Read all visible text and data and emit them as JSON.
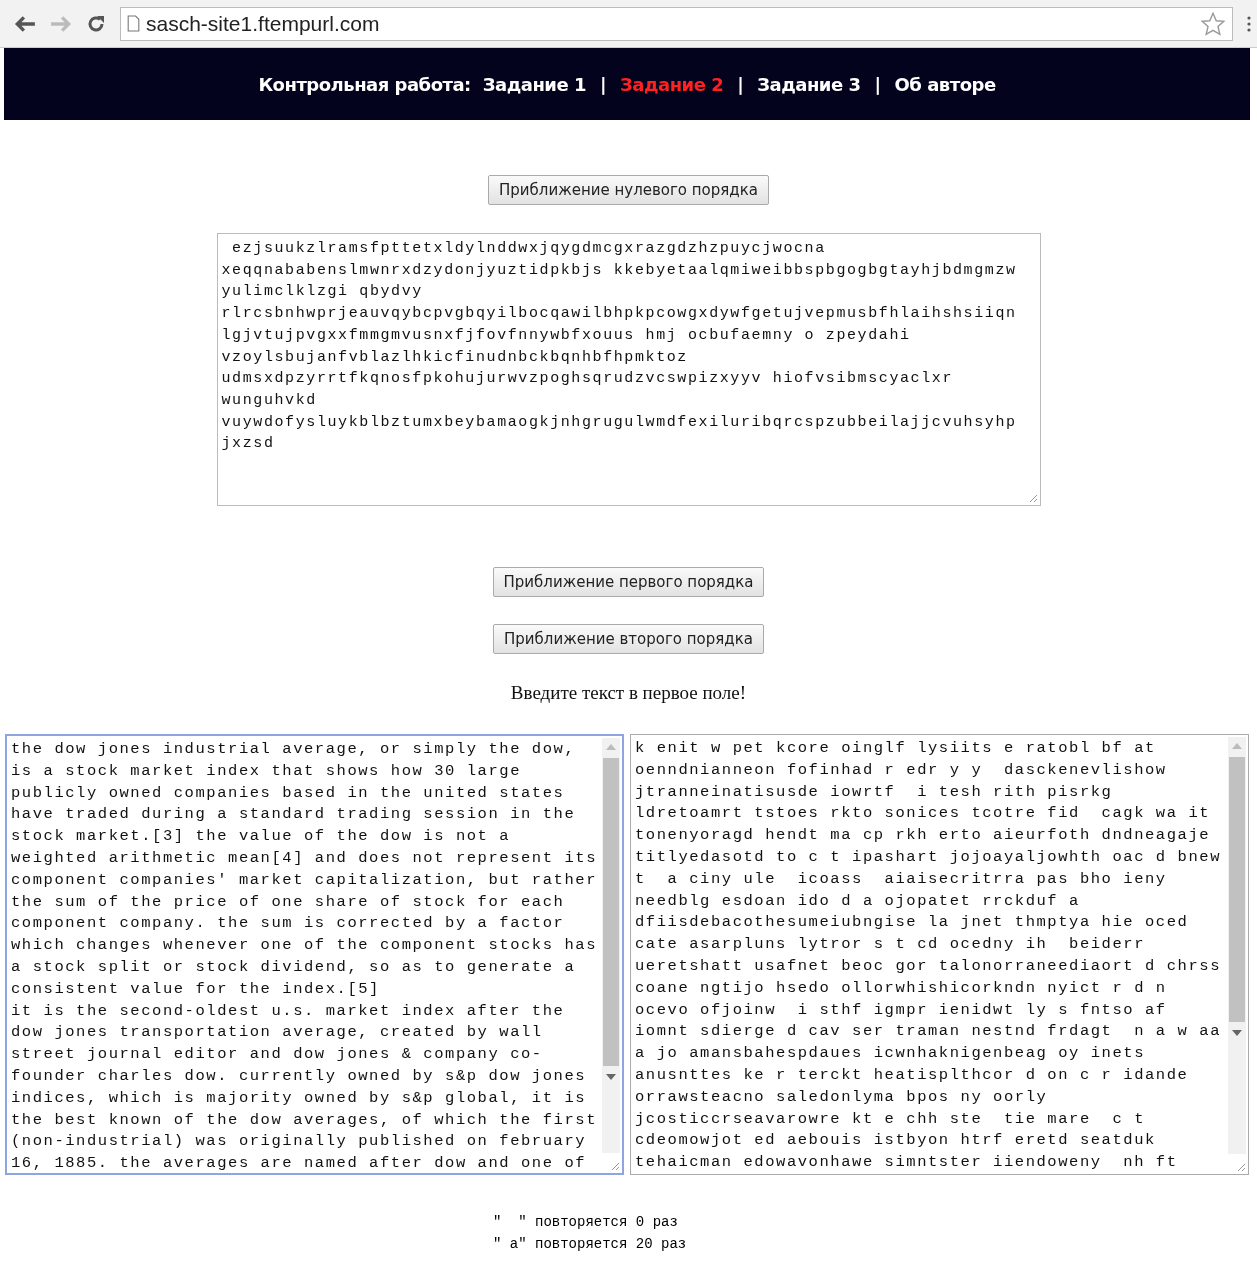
{
  "browser": {
    "url": "sasch-site1.ftempurl.com"
  },
  "nav": {
    "title": "Контрольная работа:",
    "items": [
      {
        "label": "Задание 1",
        "selected": false
      },
      {
        "label": "Задание 2",
        "selected": true
      },
      {
        "label": "Задание 3",
        "selected": false
      },
      {
        "label": "Об авторе",
        "selected": false
      }
    ],
    "separators": [
      "|",
      "|",
      "|"
    ]
  },
  "button_zero": "Приближение нулевого порядка",
  "output_field": {
    "lines": [
      " ezjsuukzlramsfpttetxldylnddwxjqygdmcgxrazgdzhzpuycjwocna",
      "xeqqnababenslmwnrxdzydonjyuztidpkbjs kkebyetaalqmiweibbspbgogbgtayhjbdmgmzw",
      "yulimclklzgi qbydvy",
      "rlrcsbnhwprjeauvqybcpvgbqyilbocqawilbhpkpcowgxdywfgetujvepmusbfhlaihshsiiqn",
      "lgjvtujpvgxxfmmgmvusnxfjfovfnnywbfxouus hmj ocbufaemny o zpeydahi",
      "vzoylsbujanfvblazlhkicfinudnbckbqnhbfhpmktoz",
      "udmsxdpzyrrtfkqnosfpkohujurwvzpoghsqrudzvcswpizxyyv hiofvsibmscyaclxr",
      "wunguhvkd",
      "vuywdofysluykblbztumxbeybamaogkjnhgrugulwmdfexiluribqrcspzubbeilajjcvuhsyhp",
      "jxzsd"
    ]
  },
  "button_first": "Приближение первого порядка",
  "button_second": "Приближение второго порядка",
  "prompt": "Введите текст в первое поле!",
  "input_fields": [
    {
      "focused": true,
      "lines": [
        "the dow jones industrial average, or simply the dow,",
        "is a stock market index that shows how 30 large",
        "publicly owned companies based in the united states",
        "have traded during a standard trading session in the",
        "stock market.[3] the value of the dow is not a",
        "weighted arithmetic mean[4] and does not represent its",
        "component companies' market capitalization, but rather",
        "the sum of the price of one share of stock for each",
        "component company. the sum is corrected by a factor",
        "which changes whenever one of the component stocks has",
        "a stock split or stock dividend, so as to generate a",
        "consistent value for the index.[5]",
        "it is the second-oldest u.s. market index after the",
        "dow jones transportation average, created by wall",
        "street journal editor and dow jones & company co-",
        "founder charles dow. currently owned by s&p dow jones",
        "indices, which is majority owned by s&p global, it is",
        "the best known of the dow averages, of which the first",
        "(non-industrial) was originally published on february",
        "16, 1885. the averages are named after dow and one of"
      ]
    },
    {
      "focused": false,
      "lines": [
        "k enit w pet kcore oinglf lysiits e ratobl bf at",
        "oenndnianneon fofinhad r edr y y  dasckenevlishow",
        "jtranneinatisusde iowrtf  i tesh rith pisrkg",
        "ldretoamrt tstoes rkto sonices tcotre fid  cagk wa it",
        "tonenyoragd hendt ma cp rkh erto aieurfoth dndneagaje",
        "titlyedasotd to c t ipashart jojoayaljowhth oac d bnew",
        "t  a ciny ule  icoass  aiaisecritrra pas bho ieny",
        "needblg esdoan ido d a ojopatet rrckduf a",
        "dfiisdebacothesumeiubngise la jnet thmptya hie oced",
        "cate asarpluns lytror s t cd ocedny ih  beiderr",
        "ueretshatt usafnet beoc gor talonorraneediaort d chrss",
        "coane ngtijo hsedo ollorwhishicorkndn nyict r d n",
        "ocevo ofjoinw  i sthf igmpr ienidwt ly s fntso af",
        "iomnt sdierge d cav ser traman nestnd frdagt  n a w aa",
        "a jo amansbahespdaues icwnhaknigenbeag oy inets",
        "anusnttes ke r terckt heatisplthcor d on c r idande",
        "orrawsteacno saledonlyma bpos ny oorly",
        "jcosticcrseavarowre kt e chh ste  tie mare  c t",
        "cdeomowjot ed aebouis istbyon htrf eretd seatduk",
        "tehaicman edowavonhawe simntster iiendoweny  nh ft"
      ]
    }
  ],
  "results": [
    "\"  \" повторяется 0 раз",
    "\" a\" повторяется 20 раз"
  ]
}
